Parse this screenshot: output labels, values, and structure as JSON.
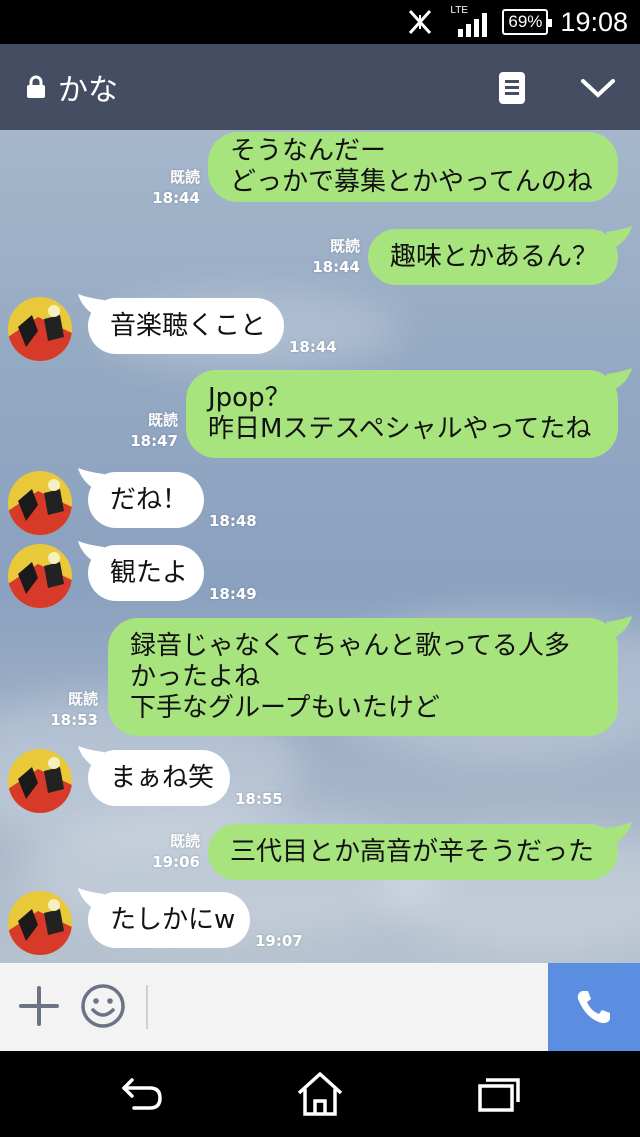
{
  "status_bar": {
    "network": "LTE",
    "battery": "69%",
    "time": "19:08"
  },
  "header": {
    "title": "かな"
  },
  "messages": [
    {
      "side": "right",
      "lines": [
        "そうなんだー",
        "どっかで募集とかやってんのね"
      ],
      "read": "既読",
      "time": "18:44"
    },
    {
      "side": "right",
      "lines": [
        "趣味とかあるん？"
      ],
      "read": "既読",
      "time": "18:44"
    },
    {
      "side": "left",
      "lines": [
        "音楽聴くこと"
      ],
      "time": "18:44"
    },
    {
      "side": "right",
      "lines": [
        "Jpop？",
        "昨日Mステスペシャルやってたね"
      ],
      "read": "既読",
      "time": "18:47"
    },
    {
      "side": "left",
      "lines": [
        "だね！"
      ],
      "time": "18:48"
    },
    {
      "side": "left",
      "lines": [
        "観たよ"
      ],
      "time": "18:49"
    },
    {
      "side": "right",
      "lines": [
        "録音じゃなくてちゃんと歌ってる人多",
        "かったよね",
        "下手なグループもいたけど"
      ],
      "read": "既読",
      "time": "18:53"
    },
    {
      "side": "left",
      "lines": [
        "まぁね笑"
      ],
      "time": "18:55"
    },
    {
      "side": "right",
      "lines": [
        "三代目とか高音が辛そうだった"
      ],
      "read": "既読",
      "time": "19:06"
    },
    {
      "side": "left",
      "lines": [
        "たしかにw"
      ],
      "time": "19:07"
    }
  ],
  "icons": {
    "status": [
      "signal-muted-icon",
      "lte-signal-icon",
      "battery-icon"
    ],
    "header": [
      "lock-icon",
      "note-icon",
      "chevron-down-icon"
    ],
    "input": [
      "plus-icon",
      "emoji-icon",
      "phone-icon"
    ],
    "nav": [
      "back-icon",
      "home-icon",
      "recent-apps-icon"
    ]
  },
  "colors": {
    "header_bg": "#454d63",
    "sent_bubble": "#a8e47e",
    "received_bubble": "#ffffff",
    "call_button": "#5b8ee0"
  }
}
